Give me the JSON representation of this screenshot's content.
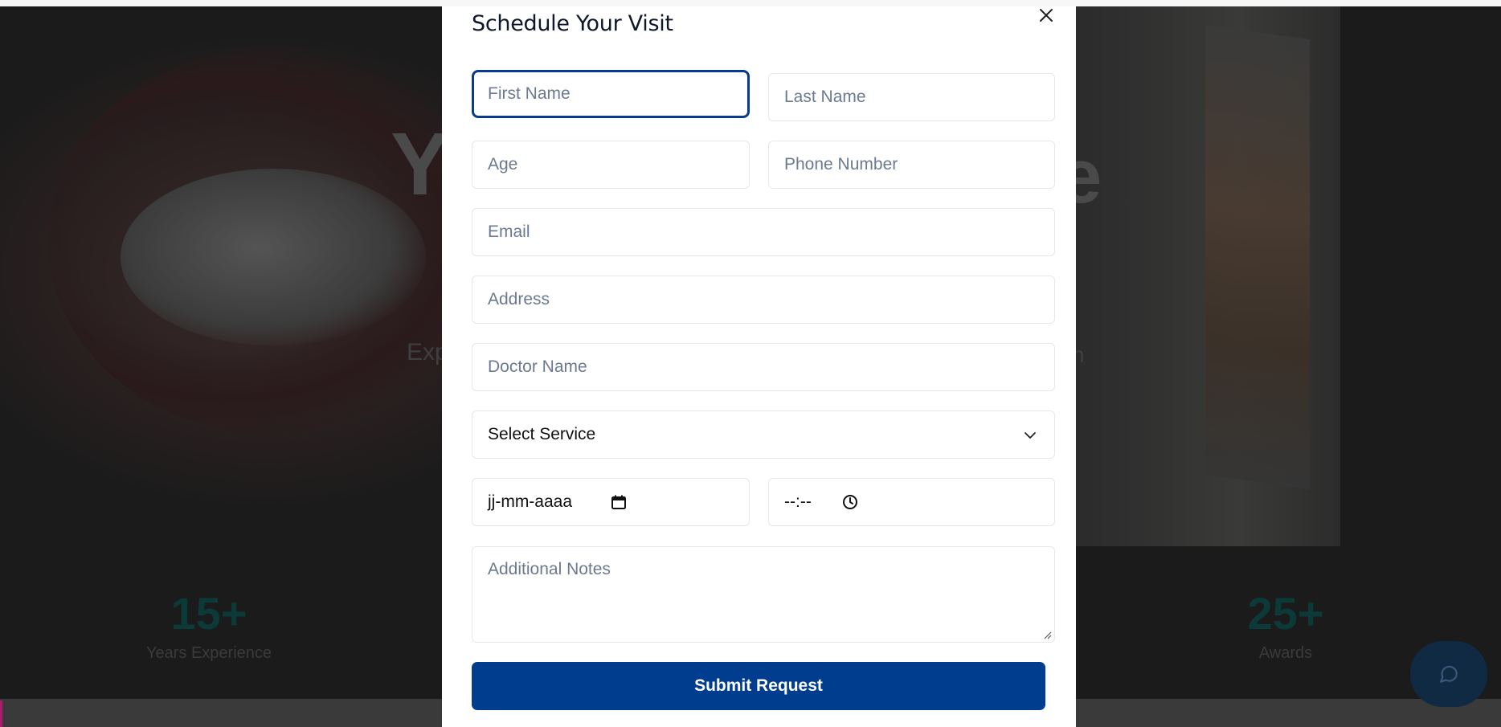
{
  "modal": {
    "title": "Schedule Your Visit",
    "fields": {
      "first_name": "First Name",
      "last_name": "Last Name",
      "age": "Age",
      "phone": "Phone Number",
      "email": "Email",
      "address": "Address",
      "doctor": "Doctor Name",
      "service_selected": "Select Service",
      "date_value": "jj-mm-aaaa",
      "time_value": "--:--",
      "notes": "Additional Notes"
    },
    "submit_label": "Submit Request",
    "accent_color": "#003d8f"
  },
  "background": {
    "hero_title_left": "Y",
    "hero_title_right": "e",
    "hero_sub_left": "Exp",
    "hero_sub_right": "n",
    "stats": [
      {
        "value": "15+",
        "label": "Years Experience"
      },
      {
        "value": "25+",
        "label": "Awards"
      }
    ]
  },
  "icons": {
    "close": "close-icon",
    "select": "chevron-down-icon",
    "date": "calendar-icon",
    "time": "clock-icon",
    "chat": "chat-bubble-icon"
  }
}
